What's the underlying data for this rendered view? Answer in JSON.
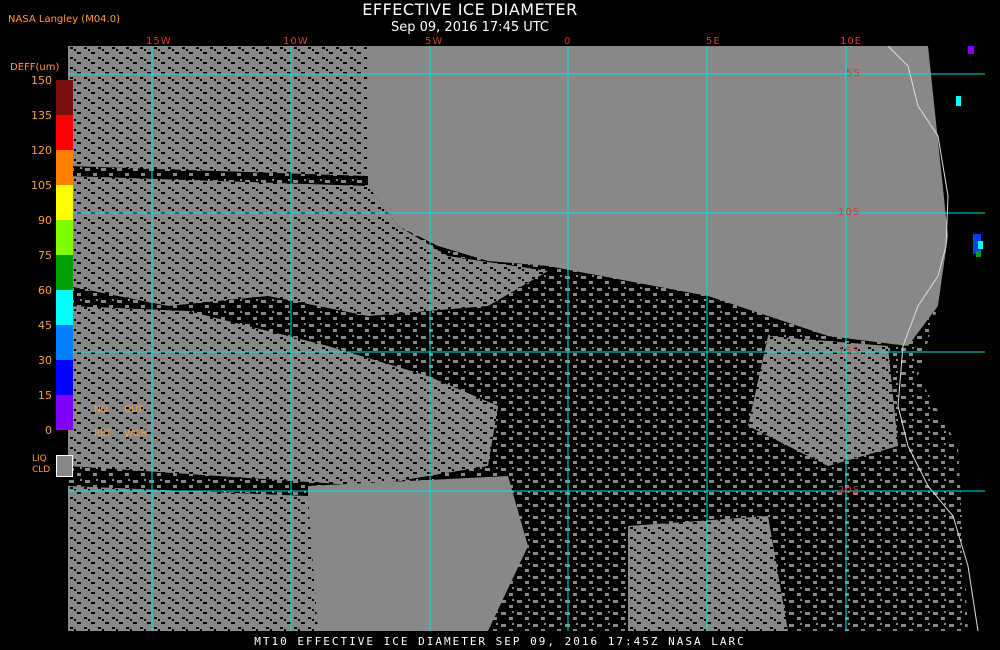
{
  "header": {
    "org": "NASA Langley (M04.0)",
    "title": "EFFECTIVE ICE DIAMETER",
    "subtitle": "Sep 09, 2016 17:45 UTC"
  },
  "legend": {
    "axis_label": "DEFF(um)",
    "ticks": [
      "150",
      "135",
      "120",
      "105",
      "90",
      "75",
      "60",
      "45",
      "30",
      "15",
      "0"
    ],
    "colors": [
      "#7a0f0f",
      "#ff0000",
      "#ff8000",
      "#ffff00",
      "#80ff00",
      "#00a000",
      "#00ffff",
      "#0080ff",
      "#0000ff",
      "#8000ff"
    ],
    "no_label": "NO",
    "out_label": "OUT",
    "ret_label": "RET",
    "valr_label": "VALR",
    "liq_label": "LIQ",
    "cld_label": "CLD",
    "liquid_color": "#888888"
  },
  "grid": {
    "lon_labels": [
      "15W",
      "10W",
      "5W",
      "0",
      "5E",
      "10E"
    ],
    "lat_labels": [
      "5S",
      "10S",
      "15S",
      "20S"
    ],
    "line_color": "#00e5e5"
  },
  "footer": {
    "text": "MT10  EFFECTIVE ICE DIAMETER  SEP 09, 2016 17:45Z  NASA LARC"
  }
}
